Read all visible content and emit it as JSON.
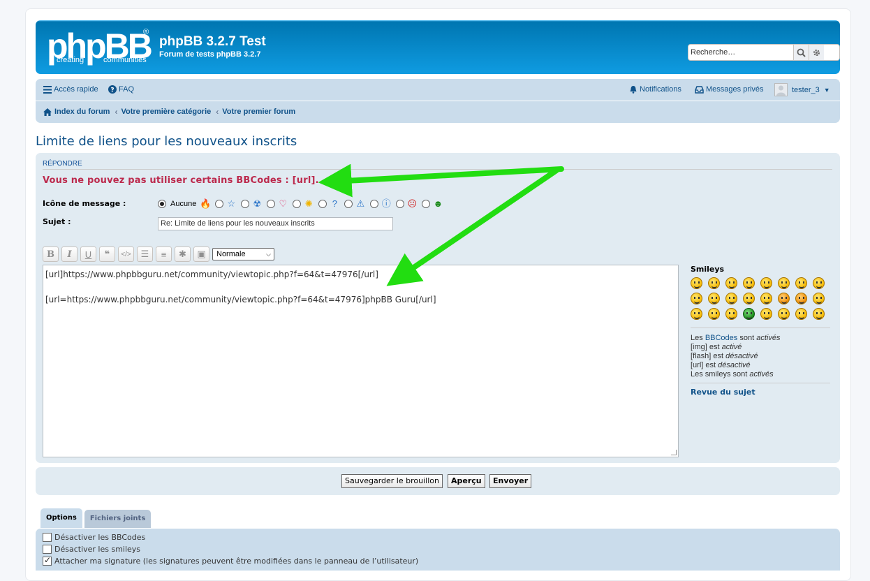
{
  "header": {
    "logo_text": "phpBB",
    "logo_reg": "®",
    "logo_sub_left": "creating",
    "logo_sub_right": "communities",
    "site_title": "phpBB 3.2.7 Test",
    "site_desc": "Forum de tests phpBB 3.2.7",
    "search_placeholder": "Recherche…",
    "search_icon": "search-icon",
    "advanced_search_icon": "gear-icon"
  },
  "nav": {
    "quick_access": "Accès rapide",
    "faq": "FAQ",
    "notifications": "Notifications",
    "private_messages": "Messages privés",
    "username": "tester_3",
    "breadcrumbs": [
      "Index du forum",
      "Votre première catégorie",
      "Votre premier forum"
    ]
  },
  "page": {
    "title": "Limite de liens pour les nouveaux inscrits",
    "section": "RÉPONDRE",
    "error": "Vous ne pouvez pas utiliser certains BBCodes : [url]."
  },
  "form": {
    "icon_label": "Icône de message :",
    "icon_none": "Aucune",
    "icon_options": [
      "fire-icon",
      "star-icon",
      "radioactive-icon",
      "heart-icon",
      "lightbulb-icon",
      "question-icon",
      "warning-icon",
      "info-icon",
      "mad-icon",
      "grin-icon"
    ],
    "subject_label": "Sujet :",
    "subject_value": "Re: Limite de liens pour les nouveaux inscrits",
    "font_size_select": "Normale",
    "message_line1": "[url]https://www.phpbbguru.net/community/viewtopic.php?f=64&t=47976[/url]",
    "message_line2": "[url=https://www.phpbbguru.net/community/viewtopic.php?f=64&t=47976]phpBB Guru[/url]"
  },
  "toolbar": {
    "bold": "B",
    "italic": "I",
    "underline": "U",
    "quote": "❝",
    "code": "</>",
    "list": "☰",
    "ordered_list": "≡",
    "list_item": "✱",
    "image": "▣"
  },
  "sidebar": {
    "smileys_title": "Smileys",
    "smiley_count": 24,
    "bb_les": "Les",
    "bb_link": "BBCodes",
    "bb_sont": "sont",
    "bb_active": "activés",
    "img": "[img] est",
    "img_state": "activé",
    "flash": "[flash] est",
    "flash_state": "désactivé",
    "url": "[url] est",
    "url_state": "désactivé",
    "smileys": "Les smileys sont",
    "smileys_state": "activés",
    "topic_review": "Revue du sujet"
  },
  "buttons": {
    "save_draft": "Sauvegarder le brouillon",
    "preview": "Aperçu",
    "submit": "Envoyer"
  },
  "tabs": [
    "Options",
    "Fichiers joints"
  ],
  "options": [
    {
      "label": "Désactiver les BBCodes",
      "checked": false
    },
    {
      "label": "Désactiver les smileys",
      "checked": false
    },
    {
      "label": "Attacher ma signature (les signatures peuvent être modifiées dans le panneau de l’utilisateur)",
      "checked": true
    }
  ],
  "colors": {
    "header_blue": "#12a3eb",
    "nav_bg": "#cadceb",
    "panel_bg": "#e1ebf2",
    "link": "#105289",
    "error": "#bc2a4d",
    "annotation_arrow": "#22dd11"
  }
}
